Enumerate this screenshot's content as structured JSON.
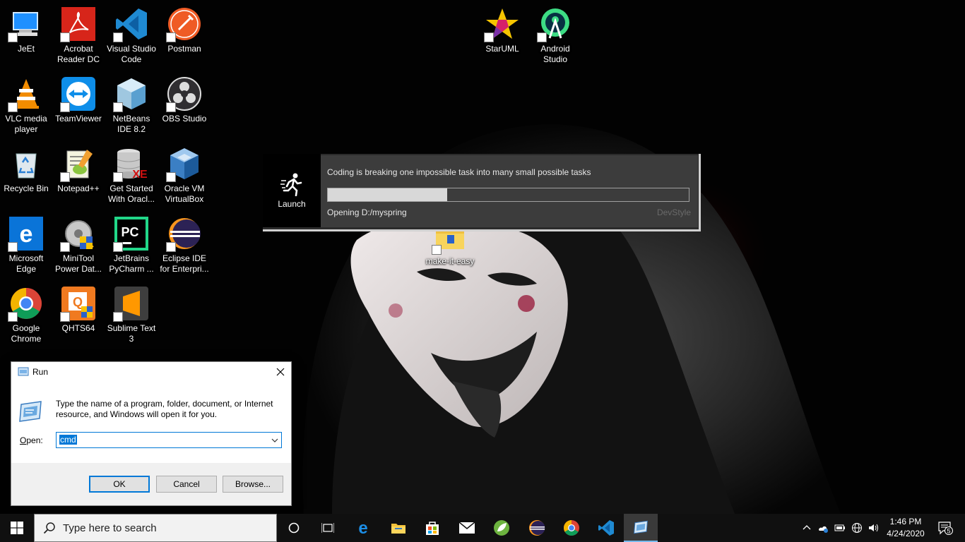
{
  "desktop": {
    "icons": [
      {
        "label": "JeEt",
        "icon": "computer-icon"
      },
      {
        "label": "Acrobat Reader DC",
        "icon": "acrobat-icon"
      },
      {
        "label": "Visual Studio Code",
        "icon": "vscode-icon"
      },
      {
        "label": "Postman",
        "icon": "postman-icon"
      },
      {
        "label": "StarUML",
        "icon": "staruml-icon"
      },
      {
        "label": "Android Studio",
        "icon": "android-studio-icon"
      },
      {
        "label": "VLC media player",
        "icon": "vlc-icon"
      },
      {
        "label": "TeamViewer",
        "icon": "teamviewer-icon"
      },
      {
        "label": "NetBeans IDE 8.2",
        "icon": "netbeans-icon"
      },
      {
        "label": "OBS Studio",
        "icon": "obs-icon"
      },
      {
        "label": "Recycle Bin",
        "icon": "recycle-bin-icon"
      },
      {
        "label": "Notepad++",
        "icon": "notepadpp-icon"
      },
      {
        "label": "Get Started With Oracl...",
        "icon": "oracle-db-icon"
      },
      {
        "label": "Oracle VM VirtualBox",
        "icon": "virtualbox-icon"
      },
      {
        "label": "Microsoft Edge",
        "icon": "edge-icon"
      },
      {
        "label": "MiniTool Power Dat...",
        "icon": "minitool-icon"
      },
      {
        "label": "JetBrains PyCharm ...",
        "icon": "pycharm-icon"
      },
      {
        "label": "Eclipse IDE for Enterpri...",
        "icon": "eclipse-icon"
      },
      {
        "label": "Google Chrome",
        "icon": "chrome-icon"
      },
      {
        "label": "QHTS64",
        "icon": "qhts-icon"
      },
      {
        "label": "Sublime Text 3",
        "icon": "sublime-icon"
      },
      {
        "label": "make-it-easy",
        "icon": "folder-icon"
      }
    ]
  },
  "splash": {
    "launch_label": "Launch",
    "message": "Coding is breaking one impossible task into many small possible tasks",
    "progress": 0.33,
    "status": "Opening D:/myspring",
    "brand": "DevStyle"
  },
  "run_dialog": {
    "title": "Run",
    "description": "Type the name of a program, folder, document, or Internet resource, and Windows will open it for you.",
    "open_label": "Open:",
    "open_value": "cmd",
    "ok": "OK",
    "cancel": "Cancel",
    "browse": "Browse..."
  },
  "taskbar": {
    "search_placeholder": "Type here to search",
    "apps": [
      "task-view-icon",
      "edge-icon",
      "file-explorer-icon",
      "store-icon",
      "mail-icon",
      "spring-tools-icon",
      "eclipse-icon",
      "chrome-icon",
      "vscode-icon",
      "run-icon"
    ],
    "time": "1:46 PM",
    "date": "4/24/2020",
    "notification_count": "5"
  },
  "colors": {
    "accent": "#0078d7",
    "taskbar": "#101010",
    "splash_panel": "#3c3c3c"
  }
}
